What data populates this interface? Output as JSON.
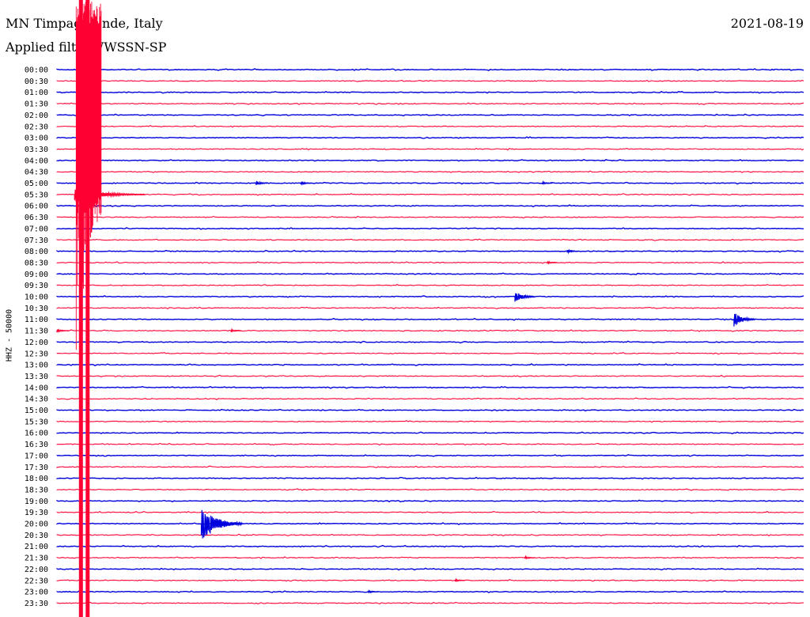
{
  "header": {
    "station": "MN Timpaga",
    "station_suffix": "nde, Italy",
    "date": "2021-08-19",
    "filter_prefix": "Applied filt",
    "filter_suffix": ": WWSSN-SP"
  },
  "chart_data": {
    "type": "line",
    "title": "MN Timpagrande, Italy",
    "date": "2021-08-19",
    "filter": "WWSSN-SP",
    "ylabel": "HHZ - 50000",
    "trace_colors": [
      "#0000dd",
      "#ff0033"
    ],
    "row_labels": [
      "00:00",
      "00:30",
      "01:00",
      "01:30",
      "02:00",
      "02:30",
      "03:00",
      "03:30",
      "04:00",
      "04:30",
      "05:00",
      "05:30",
      "06:00",
      "06:30",
      "07:00",
      "07:30",
      "08:00",
      "08:30",
      "09:00",
      "09:30",
      "10:00",
      "10:30",
      "11:00",
      "11:30",
      "12:00",
      "12:30",
      "13:00",
      "13:30",
      "14:00",
      "14:30",
      "15:00",
      "15:30",
      "16:00",
      "16:30",
      "17:00",
      "17:30",
      "18:00",
      "18:30",
      "19:00",
      "19:30",
      "20:00",
      "20:30",
      "21:00",
      "21:30",
      "22:00",
      "22:30",
      "23:00",
      "23:30"
    ],
    "events": [
      {
        "row": "05:00",
        "minute": 8.0,
        "amplitude": 0.5
      },
      {
        "row": "05:00",
        "minute": 9.8,
        "amplitude": 0.4
      },
      {
        "row": "05:00",
        "minute": 19.5,
        "amplitude": 0.3
      },
      {
        "row": "08:00",
        "minute": 20.5,
        "amplitude": 0.4
      },
      {
        "row": "08:30",
        "minute": 19.7,
        "amplitude": 0.3
      },
      {
        "row": "10:00",
        "minute": 18.4,
        "amplitude": 1.3
      },
      {
        "row": "11:00",
        "minute": 27.2,
        "amplitude": 1.5
      },
      {
        "row": "11:30",
        "minute": 0.0,
        "amplitude": 0.4
      },
      {
        "row": "11:30",
        "minute": 7.0,
        "amplitude": 0.3
      },
      {
        "row": "20:00",
        "minute": 5.8,
        "amplitude": 3.5
      },
      {
        "row": "21:30",
        "minute": 18.8,
        "amplitude": 0.3
      },
      {
        "row": "22:30",
        "minute": 16.0,
        "amplitude": 0.3
      },
      {
        "row": "23:00",
        "minute": 12.5,
        "amplitude": 0.3
      }
    ],
    "teleseism": {
      "start_row": "05:30",
      "start_minute": 0.9,
      "peak_rows": [
        "04:00",
        "05:30"
      ],
      "note": "large saturated arrival spanning many rows"
    }
  }
}
